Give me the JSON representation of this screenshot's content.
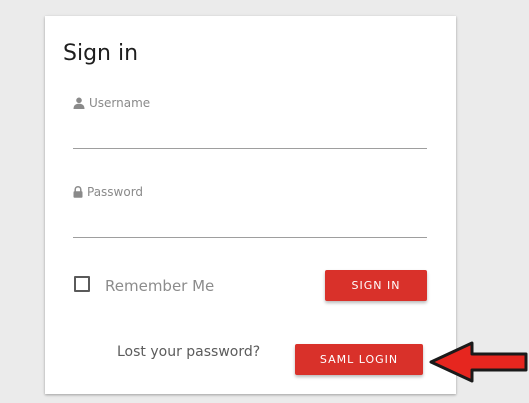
{
  "form": {
    "title": "Sign in",
    "username": {
      "label": "Username",
      "value": ""
    },
    "password": {
      "label": "Password",
      "value": ""
    },
    "remember_me": {
      "label": "Remember Me",
      "checked": false
    },
    "sign_in_label": "SIGN IN",
    "lost_password_label": "Lost your password?",
    "saml_login_label": "SAML LOGIN"
  },
  "colors": {
    "background": "#ebebeb",
    "card": "#ffffff",
    "button": "#d9312a",
    "annotation_arrow": "#e6261f"
  },
  "icons": {
    "username": "user-icon",
    "password": "lock-icon",
    "annotation": "red-arrow-icon"
  }
}
